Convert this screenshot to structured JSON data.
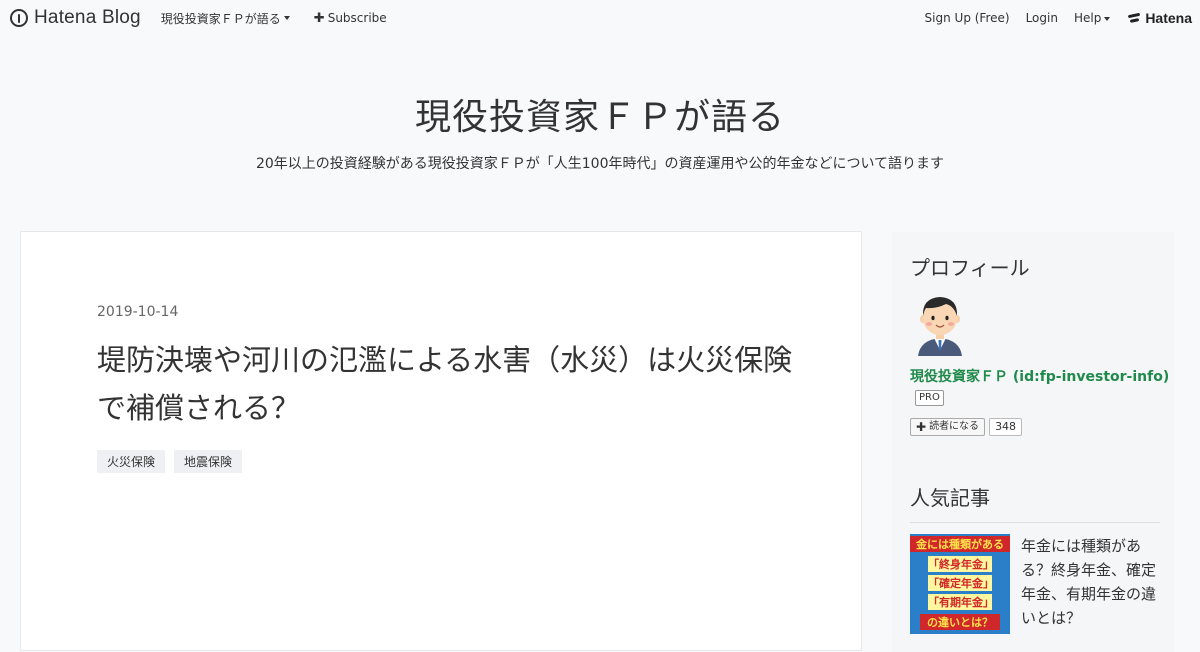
{
  "global_header": {
    "logo_text": "Hatena Blog",
    "blog_menu_label": "現役投資家ＦＰが語る",
    "subscribe_label": "Subscribe",
    "signup_label": "Sign Up (Free)",
    "login_label": "Login",
    "help_label": "Help",
    "hatena_label": "Hatena"
  },
  "blog": {
    "title": "現役投資家ＦＰが語る",
    "description": "20年以上の投資経験がある現役投資家ＦＰが「人生100年時代」の資産運用や公的年金などについて語ります"
  },
  "article": {
    "date": "2019-10-14",
    "title": "堤防決壊や河川の氾濫による水害（水災）は火災保険で補償される？",
    "categories": [
      "火災保険",
      "地震保険"
    ]
  },
  "sidebar": {
    "profile": {
      "title": "プロフィール",
      "name": "現役投資家ＦＰ (id:fp-investor-info)",
      "badge": "PRO",
      "subscribe_label": "読者になる",
      "subscriber_count": "348"
    },
    "popular": {
      "title": "人気記事",
      "items": [
        {
          "title": "年金には種類がある？終身年金、確定年金、有期年金の違いとは？",
          "thumb_lines": [
            "金には種類がある",
            "「終身年金」",
            "「確定年金」",
            "「有期年金」",
            "の違いとは？"
          ]
        }
      ]
    }
  },
  "colors": {
    "page_bg": "#f8f9fb",
    "profile_name": "#1f8a4a",
    "thumb_bg": "#2a7fc8"
  }
}
